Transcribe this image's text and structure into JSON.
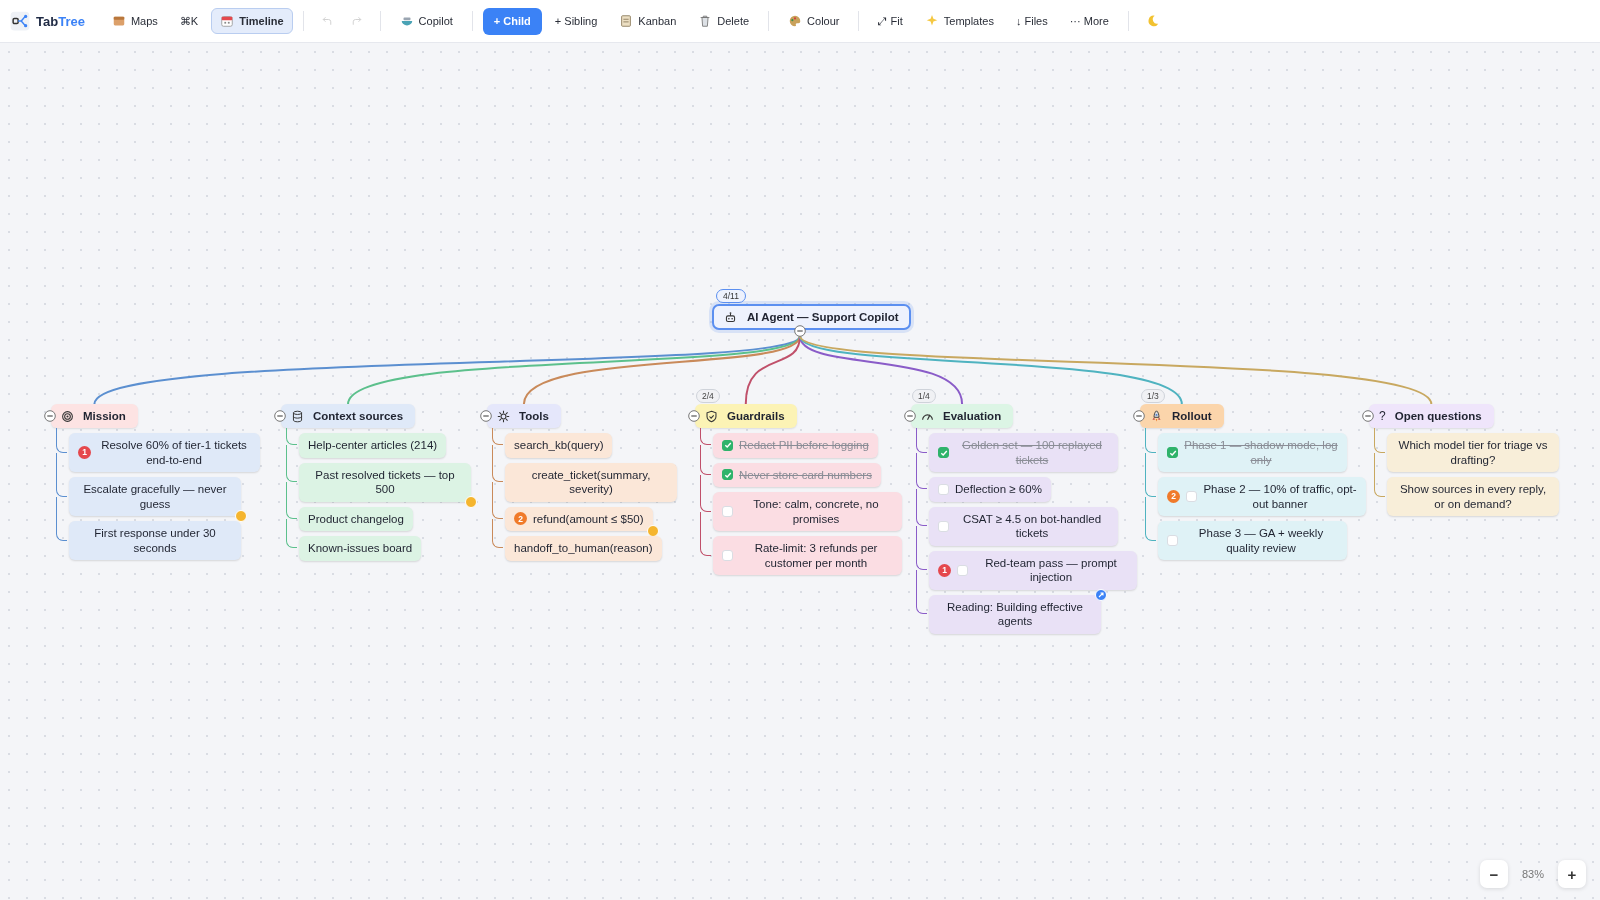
{
  "toolbar": {
    "logo": {
      "name": "Tab",
      "accent": "Tree"
    },
    "groups": [
      [
        {
          "kind": "button",
          "label": "Maps",
          "selected": false
        },
        {
          "kind": "button",
          "label": "⌘K",
          "selected": false
        },
        {
          "kind": "button",
          "label": "Timeline",
          "selected": true
        }
      ],
      [
        {
          "kind": "icon",
          "disabled": true
        },
        {
          "kind": "icon",
          "disabled": true
        }
      ],
      [
        {
          "kind": "button",
          "label": "Copilot"
        }
      ],
      [
        {
          "kind": "primary",
          "label": "+ Child"
        },
        {
          "kind": "button",
          "label": "+ Sibling"
        },
        {
          "kind": "button",
          "label": "Kanban"
        },
        {
          "kind": "button",
          "label": "Delete"
        }
      ],
      [
        {
          "kind": "button",
          "label": "Colour"
        }
      ],
      [
        {
          "kind": "button",
          "label": "⤢ Fit"
        },
        {
          "kind": "button",
          "label": "Templates"
        },
        {
          "kind": "button",
          "label": "↓ Files"
        },
        {
          "kind": "button",
          "label": "··· More"
        }
      ],
      [
        {
          "kind": "icon"
        }
      ]
    ]
  },
  "root": {
    "label": "AI Agent — Support Copilot",
    "progress": "4/11",
    "expanded": true
  },
  "branches": [
    {
      "label": "Mission",
      "expanded": true,
      "color": "#5b8fd0",
      "children": [
        {
          "kind": "note",
          "text": "Resolve 60% of tier-1 tickets end-to-end",
          "priority": {
            "text": "1",
            "color": "#e5484d"
          }
        },
        {
          "kind": "note",
          "text": "Escalate gracefully — never guess",
          "has_note": true
        },
        {
          "kind": "note",
          "text": "First response under 30 seconds"
        }
      ]
    },
    {
      "label": "Context sources",
      "expanded": true,
      "color": "#5cc08c",
      "children": [
        {
          "kind": "note",
          "text": "Help-center articles (214)"
        },
        {
          "kind": "note",
          "text": "Past resolved tickets — top 500",
          "has_note": true
        },
        {
          "kind": "note",
          "text": "Product changelog"
        },
        {
          "kind": "note",
          "text": "Known-issues board"
        }
      ]
    },
    {
      "label": "Tools",
      "expanded": true,
      "color": "#c98a5a",
      "children": [
        {
          "kind": "note",
          "text": "search_kb(query)"
        },
        {
          "kind": "note",
          "text": "create_ticket(summary, severity)"
        },
        {
          "kind": "note",
          "text": "refund(amount ≤ $50)",
          "priority": {
            "text": "2",
            "color": "#f07a2a"
          },
          "has_note": true
        },
        {
          "kind": "note",
          "text": "handoff_to_human(reason)"
        }
      ]
    },
    {
      "label": "Guardrails",
      "progress": "2/4",
      "expanded": true,
      "color": "#c0506a",
      "children": [
        {
          "kind": "task",
          "text": "Redact PII before logging",
          "checked": true
        },
        {
          "kind": "task",
          "text": "Never store card numbers",
          "checked": true
        },
        {
          "kind": "task",
          "text": "Tone: calm, concrete, no promises",
          "checked": false
        },
        {
          "kind": "task",
          "text": "Rate-limit: 3 refunds per customer per month",
          "checked": false
        }
      ]
    },
    {
      "label": "Evaluation",
      "progress": "1/4",
      "expanded": true,
      "color": "#8a5cc8",
      "children": [
        {
          "kind": "task",
          "text": "Golden set — 100 replayed tickets",
          "checked": true
        },
        {
          "kind": "task",
          "text": "Deflection ≥ 60%",
          "checked": false
        },
        {
          "kind": "task",
          "text": "CSAT ≥ 4.5 on bot-handled tickets",
          "checked": false
        },
        {
          "kind": "task",
          "text": "Red-team pass — prompt injection",
          "checked": false,
          "priority": {
            "text": "1",
            "color": "#e5484d"
          }
        },
        {
          "kind": "note",
          "text": "Reading: Building effective agents",
          "has_link": true
        }
      ]
    },
    {
      "label": "Rollout",
      "progress": "1/3",
      "expanded": true,
      "color": "#4fb3c0",
      "children": [
        {
          "kind": "task",
          "text": "Phase 1 — shadow mode, log only",
          "checked": true
        },
        {
          "kind": "task",
          "text": "Phase 2 — 10% of traffic, opt-out banner",
          "checked": false,
          "priority": {
            "text": "2",
            "color": "#f07a2a"
          }
        },
        {
          "kind": "task",
          "text": "Phase 3 — GA + weekly quality review",
          "checked": false
        }
      ]
    },
    {
      "label": "Open questions",
      "glyph": "?",
      "expanded": true,
      "color": "#c8a860",
      "children": [
        {
          "kind": "note",
          "text": "Which model tier for triage vs drafting?"
        },
        {
          "kind": "note",
          "text": "Show sources in every reply, or on demand?"
        }
      ]
    }
  ],
  "zoom": {
    "minus": "−",
    "level": "83%",
    "plus": "+"
  }
}
